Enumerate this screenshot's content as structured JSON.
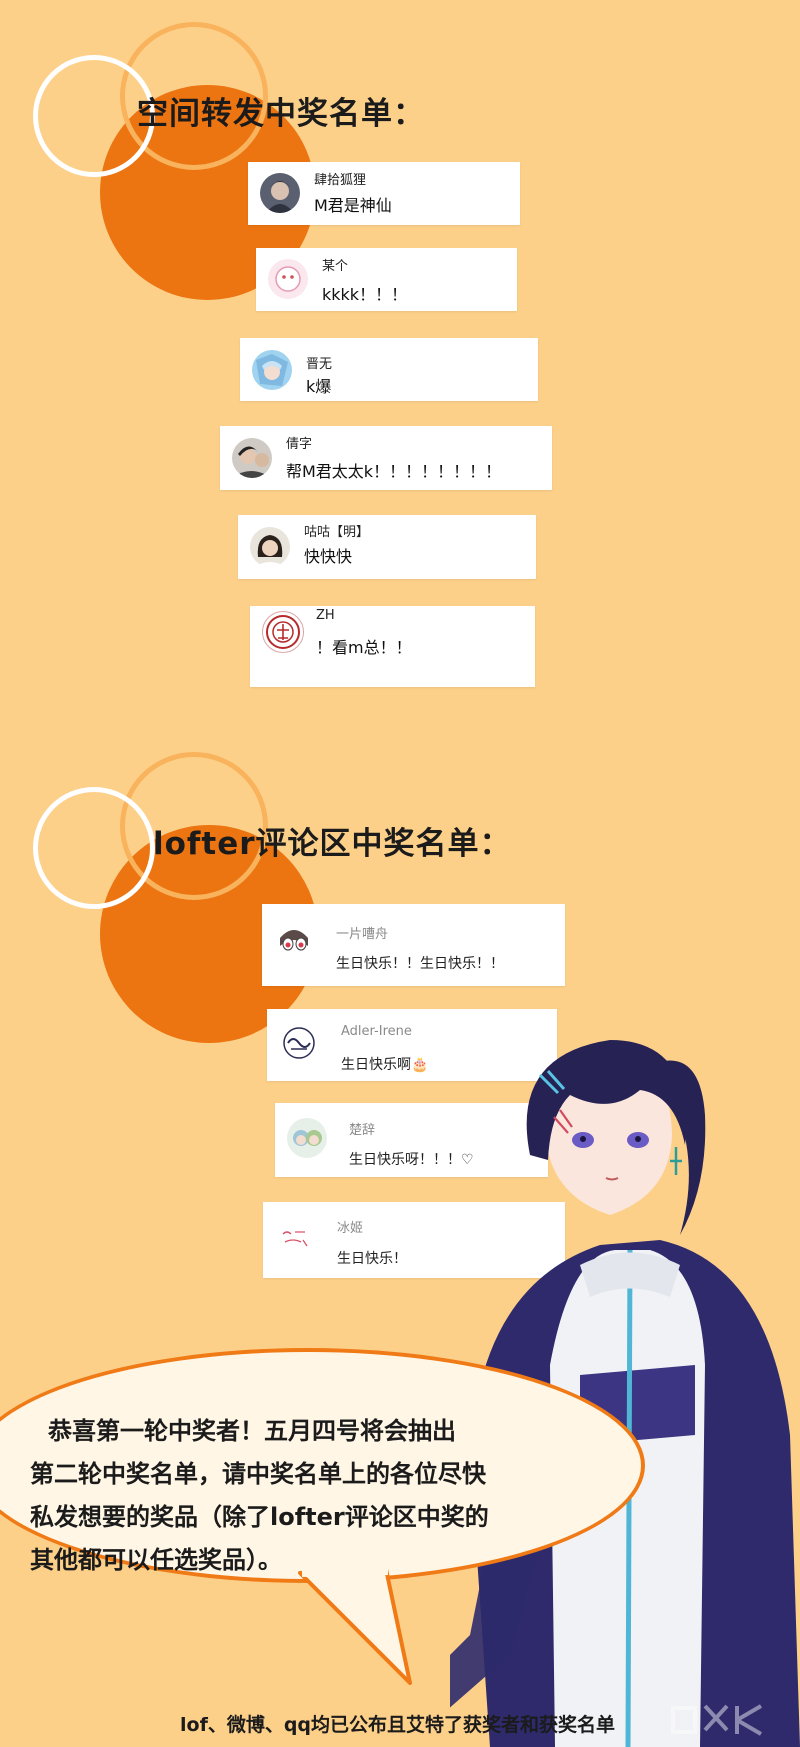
{
  "section1": {
    "title": "空间转发中奖名单：",
    "entries": [
      {
        "name": "肆拾狐狸",
        "comment": "M君是神仙"
      },
      {
        "name": "某个",
        "comment": "kkkk！！！"
      },
      {
        "name": "晋无",
        "comment": "k爆"
      },
      {
        "name": "倩字",
        "comment": "帮M君太太k！！！！！！！！"
      },
      {
        "name": "咕咕【明】",
        "comment": "快快快"
      },
      {
        "name": "ZH",
        "comment": "！看m总！！"
      }
    ]
  },
  "section2": {
    "title": "lofter评论区中奖名单：",
    "entries": [
      {
        "name": "一片嘈舟",
        "comment": "生日快乐！！生日快乐！！"
      },
      {
        "name": "Adler-Irene",
        "comment": "生日快乐啊🎂"
      },
      {
        "name": "楚辞",
        "comment": "生日快乐呀！！！♡"
      },
      {
        "name": "冰姬",
        "comment": "生日快乐！"
      }
    ]
  },
  "announcement": {
    "lines": [
      "恭喜第一轮中奖者！五月四号将会抽出",
      "第二轮中奖名单，请中奖名单上的各位尽快",
      "私发想要的奖品（除了lofter评论区中奖的",
      "其他都可以任选奖品）。"
    ]
  },
  "footer": "lof、微博、qq均已公布且艾特了获奖者和获奖名单",
  "colors": {
    "background": "#fdd08a",
    "accent": "#ec7512",
    "ring_light": "#f8b35c"
  }
}
